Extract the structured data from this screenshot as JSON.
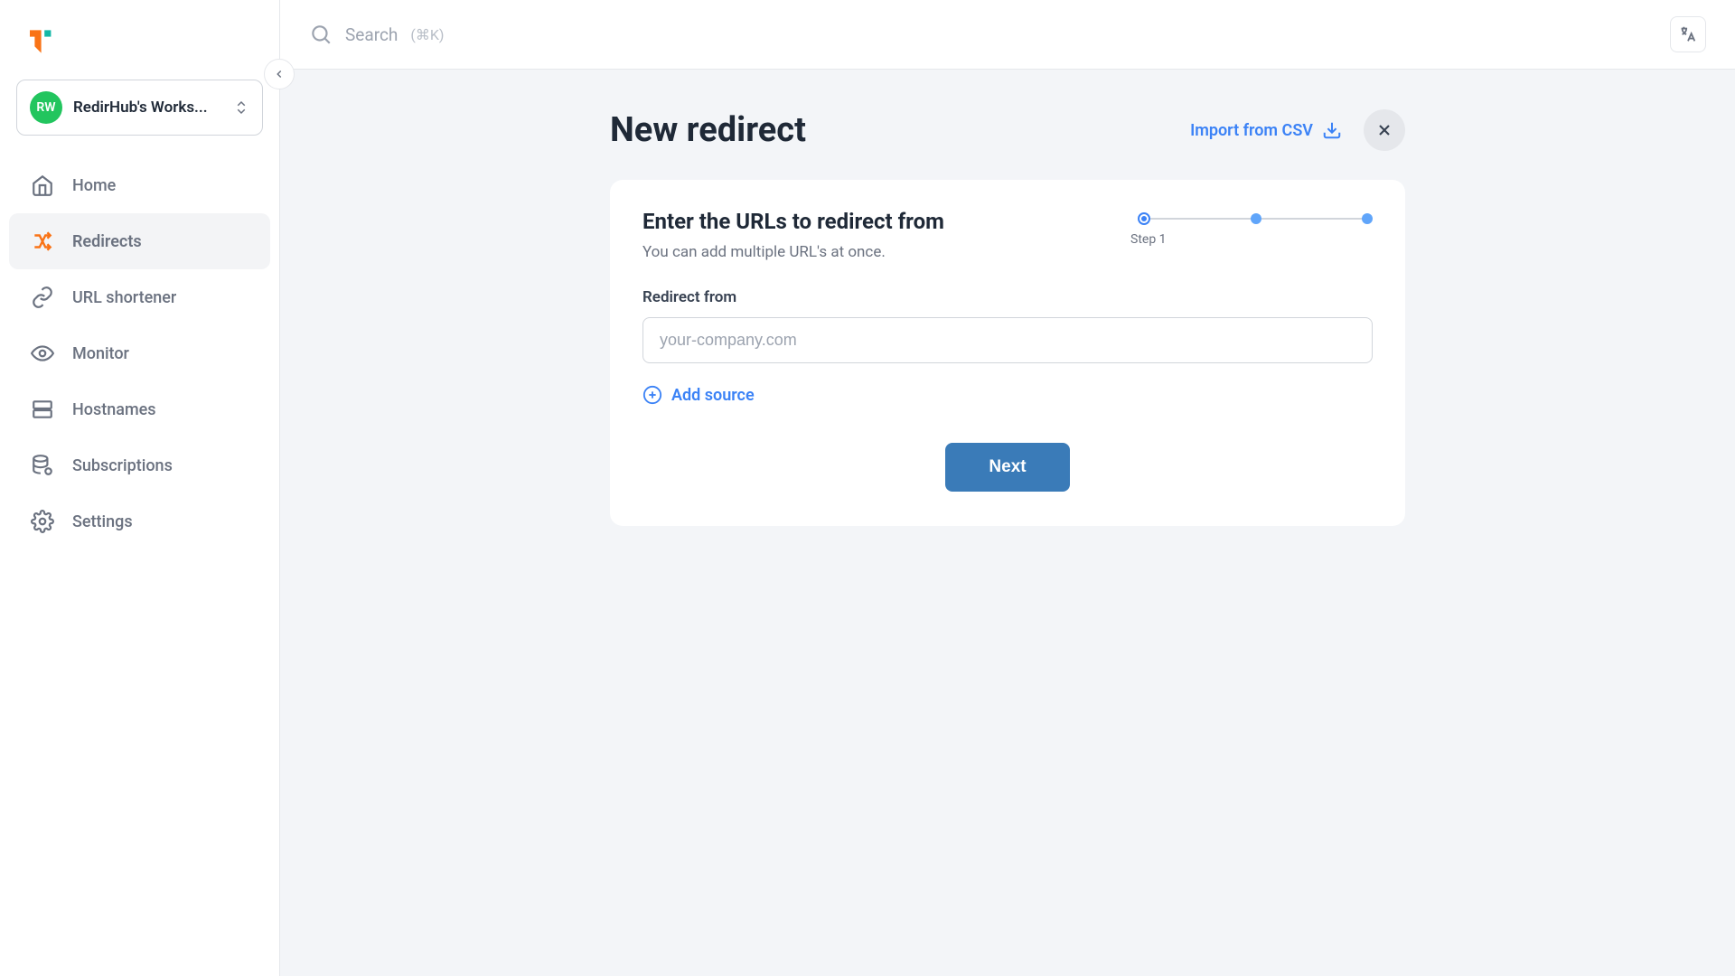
{
  "workspace": {
    "avatar_initials": "RW",
    "name": "RedirHub's Works..."
  },
  "search": {
    "label": "Search",
    "shortcut": "(⌘K)"
  },
  "sidebar": {
    "items": [
      {
        "label": "Home"
      },
      {
        "label": "Redirects"
      },
      {
        "label": "URL shortener"
      },
      {
        "label": "Monitor"
      },
      {
        "label": "Hostnames"
      },
      {
        "label": "Subscriptions"
      },
      {
        "label": "Settings"
      }
    ]
  },
  "page": {
    "title": "New redirect",
    "import_label": "Import from CSV"
  },
  "card": {
    "title": "Enter the URLs to redirect from",
    "subtitle": "You can add multiple URL's at once.",
    "step_label": "Step 1",
    "field_label": "Redirect from",
    "placeholder": "your-company.com",
    "add_source_label": "Add source",
    "next_label": "Next"
  }
}
